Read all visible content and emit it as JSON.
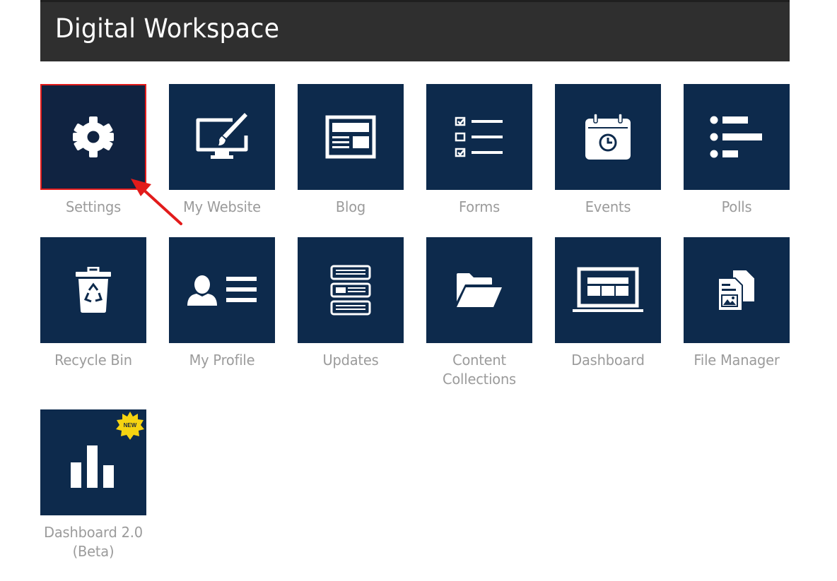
{
  "header": {
    "title": "Digital Workspace"
  },
  "colors": {
    "tile_bg": "#0d2a4c",
    "header_bg": "#2f2f2f",
    "label": "#9b9b9b",
    "highlight_border": "#e21b1b",
    "badge": "#f5d311"
  },
  "tiles": [
    {
      "label": "Settings",
      "icon": "gear-icon",
      "selected": true
    },
    {
      "label": "My Website",
      "icon": "monitor-brush-icon"
    },
    {
      "label": "Blog",
      "icon": "blog-layout-icon"
    },
    {
      "label": "Forms",
      "icon": "checklist-icon"
    },
    {
      "label": "Events",
      "icon": "calendar-clock-icon"
    },
    {
      "label": "Polls",
      "icon": "poll-bars-icon"
    },
    {
      "label": "Recycle Bin",
      "icon": "recycle-bin-icon"
    },
    {
      "label": "My Profile",
      "icon": "profile-card-icon"
    },
    {
      "label": "Updates",
      "icon": "updates-stack-icon"
    },
    {
      "label": "Content Collections",
      "icon": "folder-open-icon"
    },
    {
      "label": "Dashboard",
      "icon": "laptop-dashboard-icon"
    },
    {
      "label": "File Manager",
      "icon": "files-icon"
    },
    {
      "label": "Dashboard 2.0 (Beta)",
      "icon": "bar-chart-icon",
      "badge": "NEW"
    }
  ]
}
